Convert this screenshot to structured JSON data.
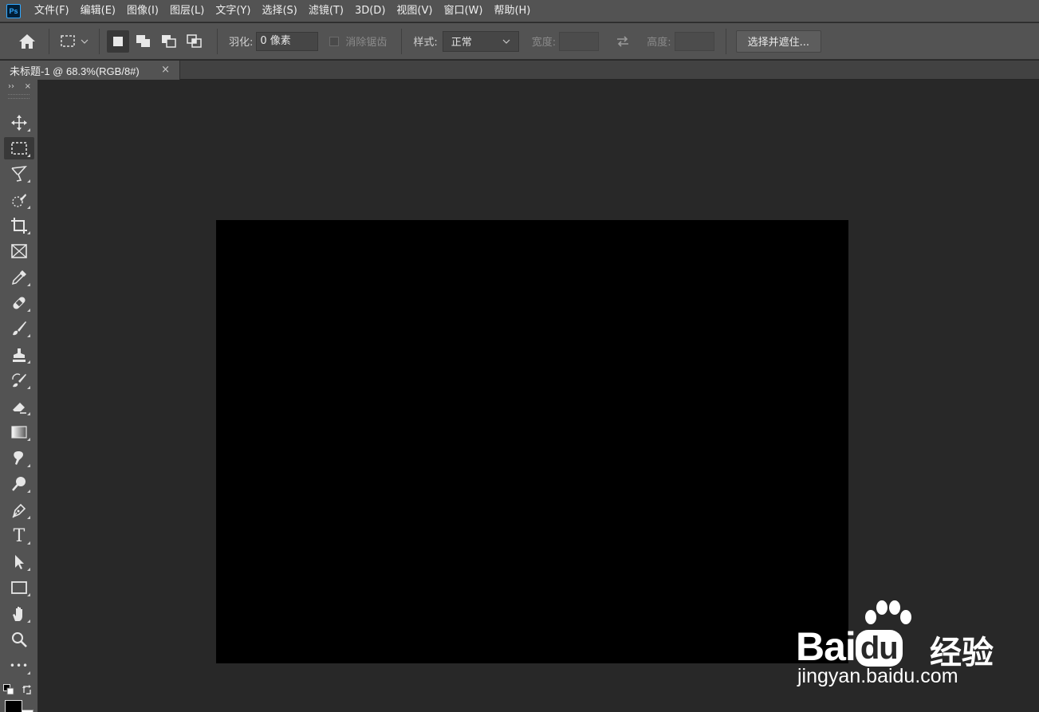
{
  "app": {
    "logo_text": "Ps"
  },
  "menu": [
    "文件(F)",
    "编辑(E)",
    "图像(I)",
    "图层(L)",
    "文字(Y)",
    "选择(S)",
    "滤镜(T)",
    "3D(D)",
    "视图(V)",
    "窗口(W)",
    "帮助(H)"
  ],
  "options": {
    "feather_label": "羽化:",
    "feather_value": "0 像素",
    "anti_alias_label": "消除锯齿",
    "style_label": "样式:",
    "style_value": "正常",
    "width_label": "宽度:",
    "height_label": "高度:",
    "select_mask_button": "选择并遮住..."
  },
  "document_tab": {
    "title": "未标题-1 @ 68.3%(RGB/8#)",
    "close_symbol": "×"
  },
  "toolbar": {
    "collapse_symbol": "››",
    "close_symbol": "×",
    "tools": [
      "move-tool",
      "rectangular-marquee-tool",
      "lasso-tool",
      "quick-selection-tool",
      "crop-tool",
      "frame-tool",
      "eyedropper-tool",
      "spot-healing-tool",
      "brush-tool",
      "clone-stamp-tool",
      "history-brush-tool",
      "eraser-tool",
      "gradient-tool",
      "smudge-tool",
      "dodge-tool",
      "pen-tool",
      "type-tool",
      "path-selection-tool",
      "rectangle-tool",
      "hand-tool",
      "zoom-tool",
      "edit-toolbar"
    ],
    "type_tool_glyph": "T",
    "more_glyph": "•••",
    "foreground_color": "#000000",
    "background_color": "#ffffff"
  },
  "canvas": {
    "fill_color": "#000000"
  },
  "watermark": {
    "brand_left": "Bai",
    "brand_du": "du",
    "brand_cn": "经验",
    "url": "jingyan.baidu.com"
  }
}
